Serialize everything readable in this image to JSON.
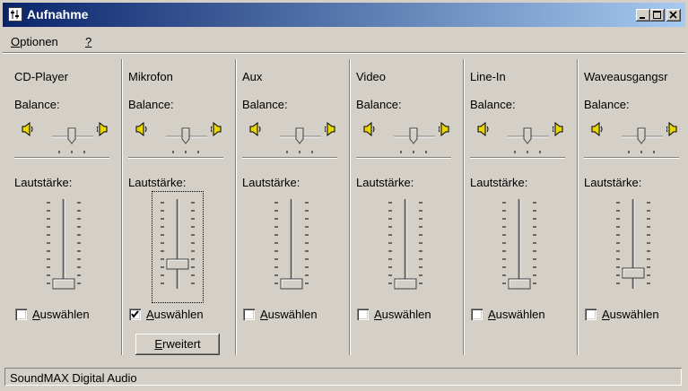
{
  "window": {
    "title": "Aufnahme",
    "title_icon": "mixer-icon",
    "controls": [
      "minimize-icon",
      "maximize-icon",
      "close-icon"
    ]
  },
  "menu": {
    "items": [
      {
        "label": "Optionen",
        "accel": "O"
      },
      {
        "label": "?",
        "accel": "?"
      }
    ]
  },
  "channels": [
    {
      "name": "CD-Player",
      "balance_label": "Balance:",
      "volume_label": "Lautstärke:",
      "select_label": "Auswählen",
      "selected": false,
      "balance": 0.5,
      "volume": 0.0
    },
    {
      "name": "Mikrofon",
      "balance_label": "Balance:",
      "volume_label": "Lautstärke:",
      "select_label": "Auswählen",
      "selected": true,
      "balance": 0.5,
      "volume": 0.25,
      "has_focus": true,
      "extra_button": "Erweitert"
    },
    {
      "name": "Aux",
      "balance_label": "Balance:",
      "volume_label": "Lautstärke:",
      "select_label": "Auswählen",
      "selected": false,
      "balance": 0.5,
      "volume": 0.0
    },
    {
      "name": "Video",
      "balance_label": "Balance:",
      "volume_label": "Lautstärke:",
      "select_label": "Auswählen",
      "selected": false,
      "balance": 0.5,
      "volume": 0.0
    },
    {
      "name": "Line-In",
      "balance_label": "Balance:",
      "volume_label": "Lautstärke:",
      "select_label": "Auswählen",
      "selected": false,
      "balance": 0.5,
      "volume": 0.0
    },
    {
      "name": "Waveausgangsr",
      "balance_label": "Balance:",
      "volume_label": "Lautstärke:",
      "select_label": "Auswählen",
      "selected": false,
      "balance": 0.5,
      "volume": 0.13
    }
  ],
  "statusbar": {
    "text": "SoundMAX Digital Audio"
  },
  "colors": {
    "titlebar_start": "#0a246a",
    "titlebar_end": "#a6caf0",
    "face": "#d4d0c8",
    "speaker": "#e8d800"
  }
}
